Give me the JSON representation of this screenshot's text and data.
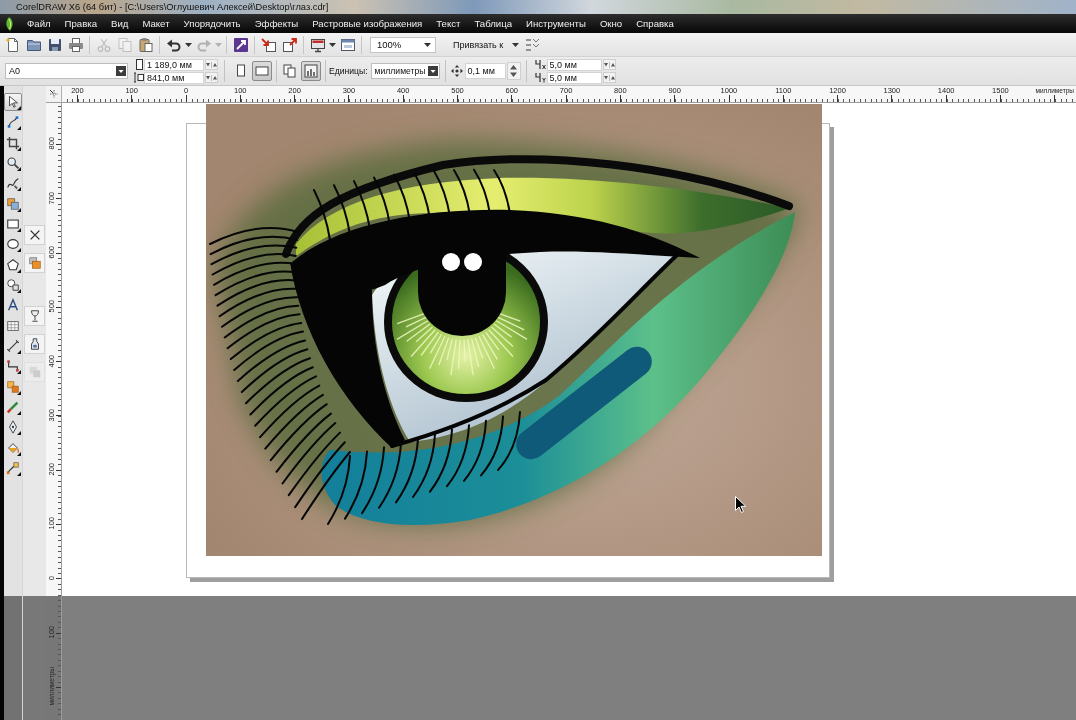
{
  "window": {
    "title": "CorelDRAW X6 (64 бит) - [C:\\Users\\Оглушевич Алексей\\Desktop\\глаз.cdr]"
  },
  "menu_bar": {
    "items": [
      "Файл",
      "Правка",
      "Вид",
      "Макет",
      "Упорядочить",
      "Эффекты",
      "Растровые изображения",
      "Текст",
      "Таблица",
      "Инструменты",
      "Окно",
      "Справка"
    ]
  },
  "standard_toolbar": {
    "groups": [
      [
        {
          "kind": "new",
          "disabled": false,
          "dropdown": false
        },
        {
          "kind": "open",
          "disabled": false,
          "dropdown": false
        },
        {
          "kind": "save",
          "disabled": false,
          "dropdown": false
        },
        {
          "kind": "print",
          "disabled": false,
          "dropdown": false
        }
      ],
      [
        {
          "kind": "cut",
          "disabled": true,
          "dropdown": false
        },
        {
          "kind": "copy",
          "disabled": true,
          "dropdown": false
        },
        {
          "kind": "paste",
          "disabled": false,
          "dropdown": false
        }
      ],
      [
        {
          "kind": "undo",
          "disabled": false,
          "dropdown": true
        },
        {
          "kind": "redo",
          "disabled": true,
          "dropdown": true
        }
      ],
      [
        {
          "kind": "launcher",
          "disabled": false,
          "dropdown": false
        }
      ],
      [
        {
          "kind": "import",
          "disabled": false,
          "dropdown": false
        },
        {
          "kind": "export",
          "disabled": false,
          "dropdown": false
        }
      ],
      [
        {
          "kind": "publish",
          "disabled": false,
          "dropdown": true
        },
        {
          "kind": "welcome",
          "disabled": false,
          "dropdown": false
        }
      ]
    ],
    "zoom_level": "100%",
    "snap_to": "Привязать к",
    "trailing_buttons": [
      {
        "kind": "options",
        "disabled": false,
        "dropdown": false
      }
    ]
  },
  "property_bar": {
    "paper_size": "A0",
    "page_width": "1 189,0 мм",
    "page_height": "841,0 мм",
    "orientation": [
      {
        "kind": "portrait",
        "selected": false
      },
      {
        "kind": "landscape",
        "selected": true
      }
    ],
    "apply_to": [
      {
        "kind": "all-pages",
        "selected": false
      },
      {
        "kind": "current-page",
        "selected": true
      }
    ],
    "units_label": "Единицы:",
    "units": "миллиметры",
    "nudge": "0,1 мм",
    "duplicate_x": "5,0 мм",
    "duplicate_y": "5,0 мм"
  },
  "toolbox": {
    "tools": [
      {
        "kind": "pick",
        "selected": true,
        "flyout": true
      },
      {
        "kind": "shape",
        "selected": false,
        "flyout": true
      },
      {
        "kind": "crop",
        "selected": false,
        "flyout": true
      },
      {
        "kind": "zoom",
        "selected": false,
        "flyout": true
      },
      {
        "kind": "freehand",
        "selected": false,
        "flyout": true
      },
      {
        "kind": "smart-fill",
        "selected": false,
        "flyout": true
      },
      {
        "kind": "rectangle",
        "selected": false,
        "flyout": true
      },
      {
        "kind": "ellipse",
        "selected": false,
        "flyout": true
      },
      {
        "kind": "polygon",
        "selected": false,
        "flyout": true
      },
      {
        "kind": "basic-shapes",
        "selected": false,
        "flyout": true
      },
      {
        "kind": "text",
        "selected": false,
        "flyout": false
      },
      {
        "kind": "table",
        "selected": false,
        "flyout": false
      },
      {
        "kind": "dimension",
        "selected": false,
        "flyout": true
      },
      {
        "kind": "connector",
        "selected": false,
        "flyout": true
      },
      {
        "kind": "blend",
        "selected": false,
        "flyout": true
      },
      {
        "kind": "eyedropper",
        "selected": false,
        "flyout": true
      },
      {
        "kind": "outline",
        "selected": false,
        "flyout": true
      },
      {
        "kind": "fill",
        "selected": false,
        "flyout": true
      },
      {
        "kind": "interactive-fill",
        "selected": false,
        "flyout": true
      }
    ]
  },
  "docker_strip": {
    "items": [
      {
        "kind": "close",
        "disabled": false
      },
      {
        "kind": "objects",
        "disabled": false
      },
      {
        "kind": "goblet",
        "disabled": false
      },
      {
        "kind": "bottle",
        "disabled": false
      },
      {
        "kind": "faded",
        "disabled": true
      }
    ]
  },
  "rulers": {
    "horizontal": {
      "labels": [
        "200",
        "100",
        "0",
        "100",
        "200",
        "300",
        "400",
        "500",
        "600",
        "700",
        "800",
        "900",
        "1000",
        "1100",
        "1200",
        "1300",
        "1400",
        "1500"
      ],
      "unit": "миллиметры"
    },
    "vertical": {
      "labels": [
        "800",
        "700",
        "600",
        "500",
        "400",
        "300",
        "200",
        "100",
        "0",
        "100"
      ],
      "unit": "миллиметры"
    }
  }
}
